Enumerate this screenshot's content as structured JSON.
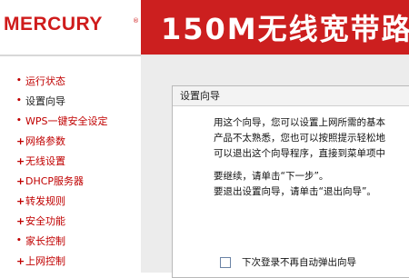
{
  "header": {
    "logo": "MERCURY",
    "logo_mark": "®",
    "title": "150M无线宽带路"
  },
  "nav": {
    "items": [
      {
        "label": "运行状态",
        "mark": "•",
        "active": false
      },
      {
        "label": "设置向导",
        "mark": "•",
        "active": true
      },
      {
        "label": "WPS一键安全设定",
        "mark": "•",
        "active": false
      },
      {
        "label": "网络参数",
        "mark": "+",
        "active": false
      },
      {
        "label": "无线设置",
        "mark": "+",
        "active": false
      },
      {
        "label": "DHCP服务器",
        "mark": "+",
        "active": false
      },
      {
        "label": "转发规则",
        "mark": "+",
        "active": false
      },
      {
        "label": "安全功能",
        "mark": "+",
        "active": false
      },
      {
        "label": "家长控制",
        "mark": "•",
        "active": false
      },
      {
        "label": "上网控制",
        "mark": "+",
        "active": false
      }
    ]
  },
  "panel": {
    "title": "设置向导",
    "lines": [
      "用这个向导，您可以设置上网所需的基本",
      "产品不太熟悉，您也可以按照提示轻松地",
      "可以退出这个向导程序，直接到菜单项中"
    ],
    "continue_text": "要继续，请单击“下一步”。",
    "exit_text": "要退出设置向导，请单击“退出向导”。",
    "checkbox_label": "下次登录不再自动弹出向导"
  },
  "colors": {
    "brand_red": "#cc1f1f",
    "nav_red": "#c00000"
  }
}
